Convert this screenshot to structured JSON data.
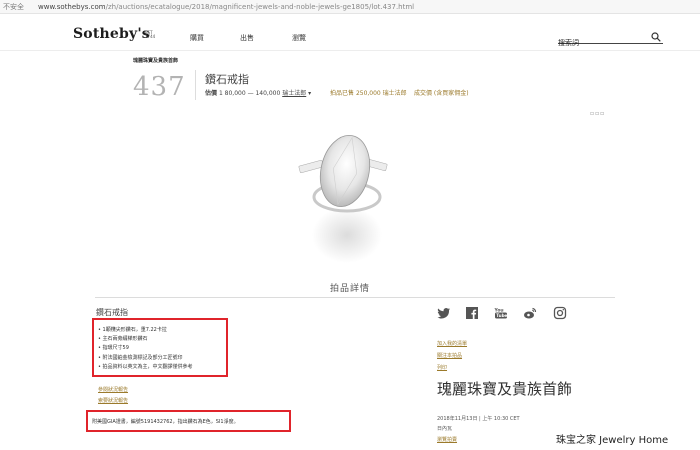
{
  "browser": {
    "info": "不安全",
    "url_host": "www.sothebys.com",
    "url_path": "/zh/auctions/ecatalogue/2018/magnificent-jewels-and-noble-jewels-ge1805/lot.437.html"
  },
  "header": {
    "logo": "Sotheby's",
    "logo_sub": "EST 1744",
    "nav": [
      "購買",
      "出售",
      "瀏覽"
    ],
    "search_placeholder": "搜索詞"
  },
  "lot": {
    "sale_title": "瑰麗珠寶及貴族首飾",
    "number": "437",
    "name": "鑽石戒指",
    "estimate_label": "估價",
    "estimate_range": "1 80,000 — 140,000",
    "currency": "瑞士法郎",
    "sold_label": "拍品已售",
    "sold_value": "250,000 瑞士法郎",
    "sold_link": "成交價 (含買家佣金)"
  },
  "details": {
    "title": "拍品詳情",
    "subtitle": "鑽石戒指",
    "desc_lines": [
      "• 1顆欖尖形鑽石，重7.22卡拉",
      "• 主石兩旁綴梯形鑽石",
      "• 指環尺寸59",
      "• 附法國鉑金檢測標記及部分工匠號印",
      "• 拍品資料以英文為主，中文翻譯僅供參考"
    ],
    "condition_link": "參閱狀況報告",
    "contact_link": "索要狀況報告",
    "gia": "附美國GIA證書，編號5191432762，指出鑽石為E色，SI1淨度。"
  },
  "sidebar": {
    "social": [
      "twitter-icon",
      "facebook-icon",
      "youtube-icon",
      "weibo-icon",
      "instagram-icon"
    ],
    "links": [
      "加入我的清單",
      "關注本拍品",
      "列印"
    ],
    "sale_name": "瑰麗珠寶及貴族首飾",
    "sale_date": "2018年11月13日 | 上午 10:30 CET",
    "sale_city": "日內瓦",
    "sale_more": "瀏覽拍賣"
  },
  "watermark": "珠宝之家 Jewelry Home",
  "colors": {
    "accent": "#9b7a2b",
    "highlight": "#e0242b"
  }
}
